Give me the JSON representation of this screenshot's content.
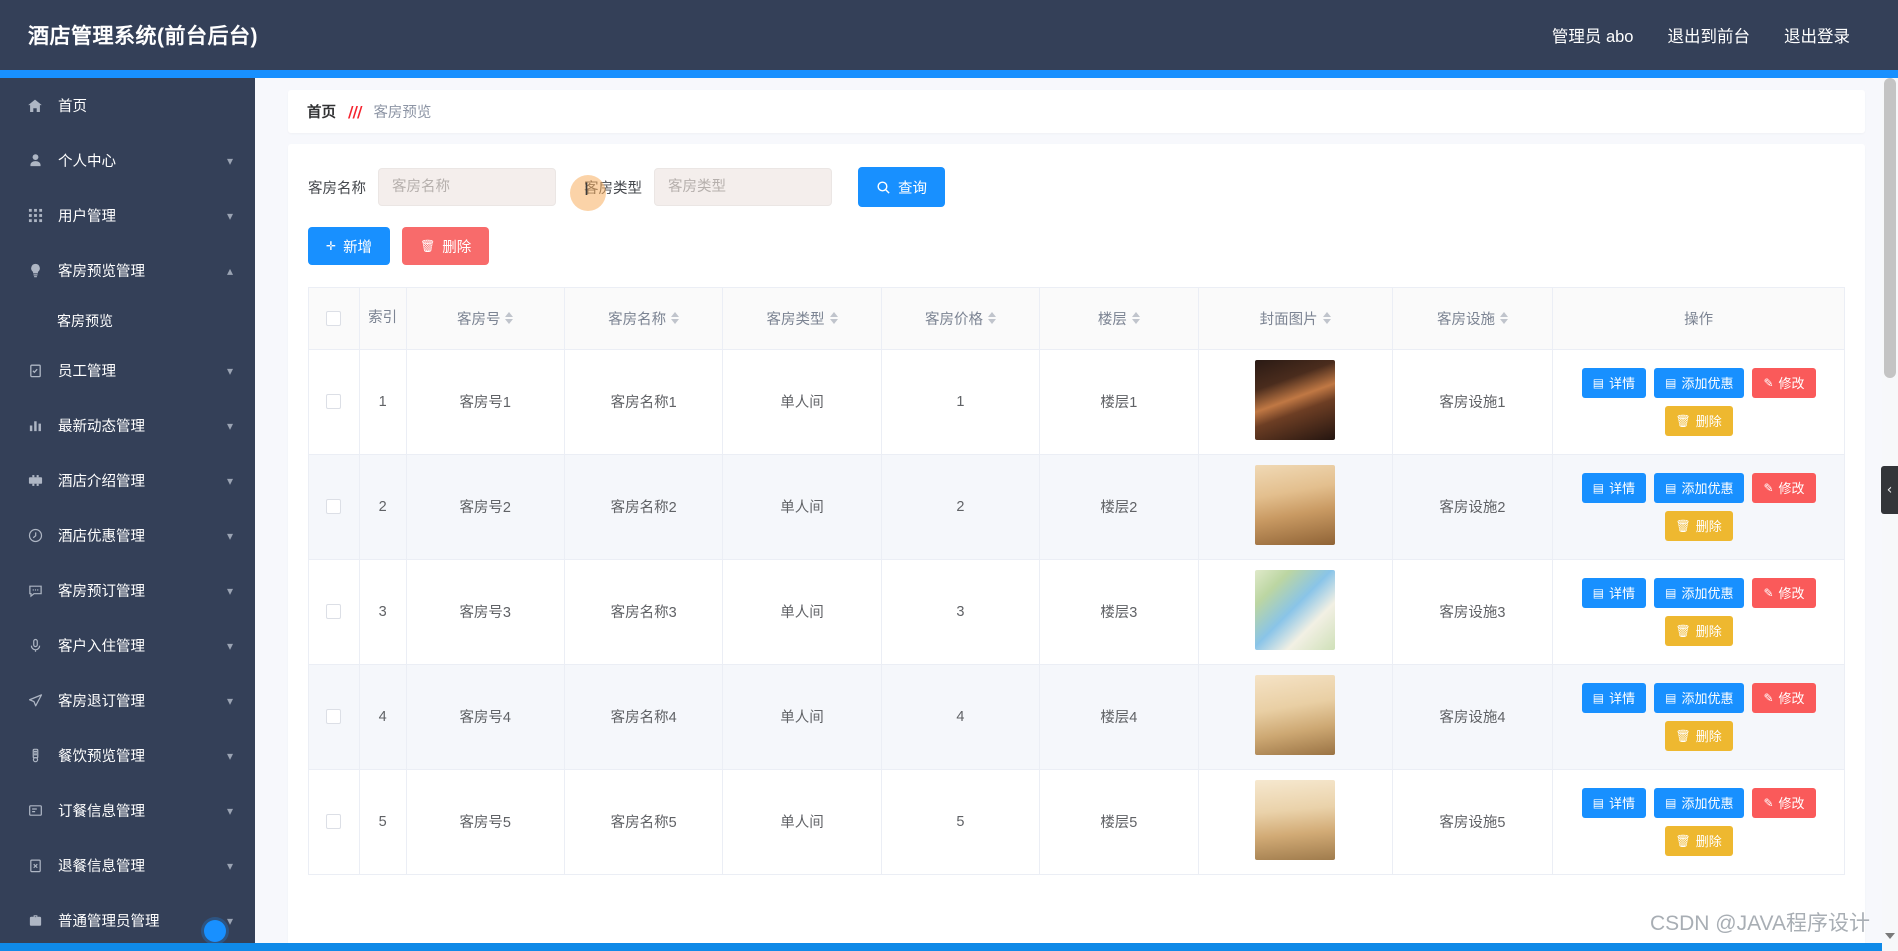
{
  "header": {
    "title": "酒店管理系统(前台后台)",
    "links": [
      {
        "label": "管理员 abo",
        "name": "admin-user-label"
      },
      {
        "label": "退出到前台",
        "name": "exit-to-frontend-link"
      },
      {
        "label": "退出登录",
        "name": "logout-link"
      }
    ]
  },
  "sidebar": {
    "items": [
      {
        "label": "首页",
        "icon": "home-icon",
        "arrow": ""
      },
      {
        "label": "个人中心",
        "icon": "user-icon",
        "arrow": "▾"
      },
      {
        "label": "用户管理",
        "icon": "grid-icon",
        "arrow": "▾"
      },
      {
        "label": "客房预览管理",
        "icon": "bulb-icon",
        "arrow": "▴"
      },
      {
        "label": "员工管理",
        "icon": "clipboard-icon",
        "arrow": "▾"
      },
      {
        "label": "最新动态管理",
        "icon": "bar-chart-icon",
        "arrow": "▾"
      },
      {
        "label": "酒店介绍管理",
        "icon": "film-icon",
        "arrow": "▾"
      },
      {
        "label": "酒店优惠管理",
        "icon": "clock-icon",
        "arrow": "▾"
      },
      {
        "label": "客房预订管理",
        "icon": "message-icon",
        "arrow": "▾"
      },
      {
        "label": "客户入住管理",
        "icon": "microphone-icon",
        "arrow": "▾"
      },
      {
        "label": "客房退订管理",
        "icon": "send-icon",
        "arrow": "▾"
      },
      {
        "label": "餐饮预览管理",
        "icon": "thermometer-icon",
        "arrow": "▾"
      },
      {
        "label": "订餐信息管理",
        "icon": "note-icon",
        "arrow": "▾"
      },
      {
        "label": "退餐信息管理",
        "icon": "clipboard-x-icon",
        "arrow": "▾"
      },
      {
        "label": "普通管理员管理",
        "icon": "briefcase-icon",
        "arrow": "▾"
      }
    ],
    "submenu": {
      "label": "客房预览",
      "parent_index": 3
    }
  },
  "breadcrumb": {
    "home": "首页",
    "separator": "///",
    "current": "客房预览"
  },
  "filter": {
    "room_name_label": "客房名称",
    "room_name_placeholder": "客房名称",
    "room_name_value": "",
    "room_type_label": "客房类型",
    "room_type_placeholder": "客房类型",
    "room_type_value": "",
    "query_label": "查询"
  },
  "actions": {
    "add_label": "新增",
    "delete_label": "删除"
  },
  "table": {
    "columns": [
      {
        "label": "",
        "name": "select-all",
        "sortable": false
      },
      {
        "label": "索引",
        "name": "index",
        "sortable": false
      },
      {
        "label": "客房号",
        "name": "room-no",
        "sortable": true
      },
      {
        "label": "客房名称",
        "name": "room-name",
        "sortable": true
      },
      {
        "label": "客房类型",
        "name": "room-type",
        "sortable": true
      },
      {
        "label": "客房价格",
        "name": "room-price",
        "sortable": true
      },
      {
        "label": "楼层",
        "name": "floor",
        "sortable": true
      },
      {
        "label": "封面图片",
        "name": "cover-image",
        "sortable": true
      },
      {
        "label": "客房设施",
        "name": "facilities",
        "sortable": true
      },
      {
        "label": "操作",
        "name": "operations",
        "sortable": false
      }
    ],
    "rows": [
      {
        "index": "1",
        "room_no": "客房号1",
        "room_name": "客房名称1",
        "room_type": "单人间",
        "price": "1",
        "floor": "楼层1",
        "facilities": "客房设施1"
      },
      {
        "index": "2",
        "room_no": "客房号2",
        "room_name": "客房名称2",
        "room_type": "单人间",
        "price": "2",
        "floor": "楼层2",
        "facilities": "客房设施2"
      },
      {
        "index": "3",
        "room_no": "客房号3",
        "room_name": "客房名称3",
        "room_type": "单人间",
        "price": "3",
        "floor": "楼层3",
        "facilities": "客房设施3"
      },
      {
        "index": "4",
        "room_no": "客房号4",
        "room_name": "客房名称4",
        "room_type": "单人间",
        "price": "4",
        "floor": "楼层4",
        "facilities": "客房设施4"
      },
      {
        "index": "5",
        "room_no": "客房号5",
        "room_name": "客房名称5",
        "room_type": "单人间",
        "price": "5",
        "floor": "楼层5",
        "facilities": "客房设施5"
      }
    ],
    "row_ops": {
      "detail": "详情",
      "promo": "添加优惠",
      "edit": "修改",
      "remove": "删除"
    }
  },
  "collapse_handle": {
    "glyph": "‹"
  },
  "watermark": "CSDN @JAVA程序设计",
  "colors": {
    "header_bg": "#344058",
    "accent": "#1890ff",
    "danger": "#f86b6b",
    "warning": "#eeb830",
    "edit": "#fa5a5a"
  }
}
